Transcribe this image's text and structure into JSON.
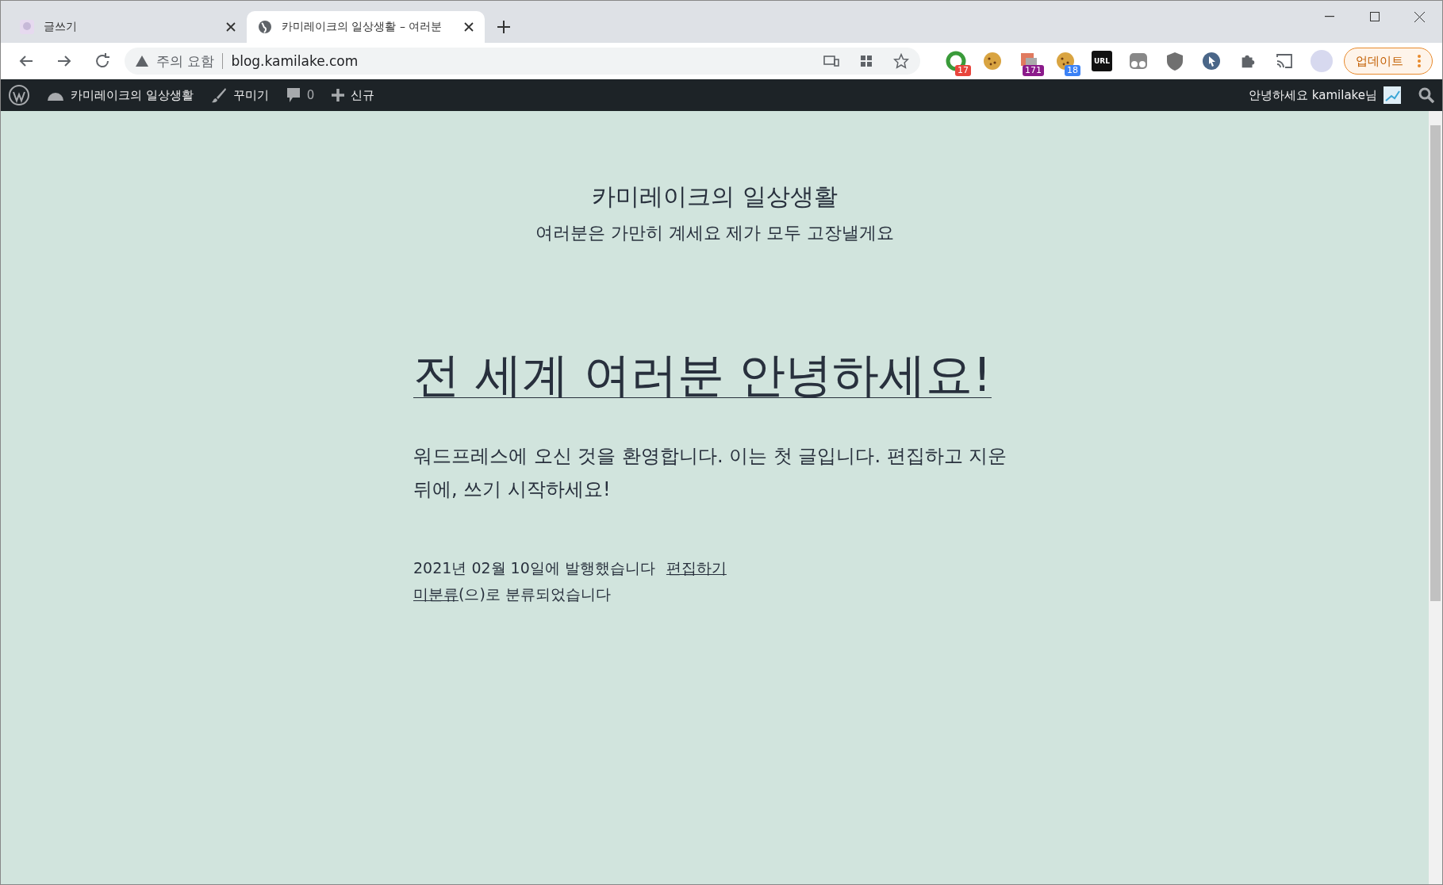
{
  "tabs": [
    {
      "title": "글쓰기",
      "selected": false,
      "kind": "avatar"
    },
    {
      "title": "카미레이크의 일상생활 – 여러분",
      "selected": true,
      "kind": "globe"
    }
  ],
  "address_bar": {
    "warning": "주의 요함",
    "url": "blog.kamilake.com"
  },
  "extensions": [
    {
      "kind": "ring",
      "badge": "17",
      "color": "#e8453c"
    },
    {
      "kind": "cookie"
    },
    {
      "kind": "stack",
      "badge": "171",
      "color": "#8b1a8b"
    },
    {
      "kind": "cookie",
      "badge": "18",
      "color": "#3b82f6"
    },
    {
      "kind": "url",
      "label": "URL"
    },
    {
      "kind": "eyes"
    },
    {
      "kind": "shield"
    },
    {
      "kind": "cursor"
    }
  ],
  "update_button": "업데이트",
  "admin_bar": {
    "site": "카미레이크의 일상생활",
    "customize": "꾸미기",
    "comments": "0",
    "new": "신규",
    "greeting": "안녕하세요 kamilake님"
  },
  "site": {
    "title": "카미레이크의 일상생활",
    "tagline": "여러분은 가만히 계세요 제가 모두 고장낼게요"
  },
  "post": {
    "title": "전 세계 여러분 안녕하세요!",
    "body": "워드프레스에 오신 것을 환영합니다. 이는 첫 글입니다. 편집하고 지운 뒤에, 쓰기 시작하세요!",
    "date": "2021년 02월 10일에 발행했습니다",
    "edit": "편집하기",
    "category": "미분류",
    "category_suffix": "(으)로 분류되었습니다"
  }
}
